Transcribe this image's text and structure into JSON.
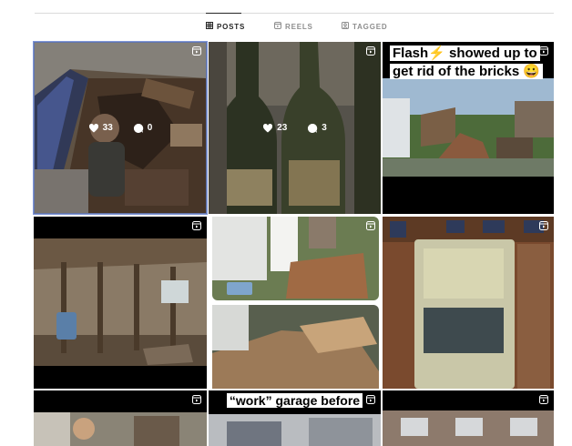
{
  "tabs": [
    {
      "label": "POSTS",
      "icon": "grid-icon",
      "active": true
    },
    {
      "label": "REELS",
      "icon": "reels-icon",
      "active": false
    },
    {
      "label": "TAGGED",
      "icon": "tagged-icon",
      "active": false
    }
  ],
  "posts": [
    {
      "kind": "photo-basement-crawlspace",
      "likes": "33",
      "comments": "0",
      "selected": true
    },
    {
      "kind": "photo-old-bottles",
      "likes": "23",
      "comments": "3"
    },
    {
      "kind": "reel-flash-bricks",
      "caption_line1": "Flash⚡ showed up to",
      "caption_line2": "get rid of the bricks 😀"
    },
    {
      "kind": "reel-gutted-interior"
    },
    {
      "kind": "reel-lumber-piles"
    },
    {
      "kind": "reel-vending-machine"
    },
    {
      "kind": "reel-kid-portrait"
    },
    {
      "kind": "reel-work-garage",
      "caption": "“work” garage before"
    },
    {
      "kind": "reel-building-exterior"
    }
  ],
  "colors": {
    "selected_border": "#7f96d8",
    "tab_active": "#262626",
    "tab_inactive": "#8e8e8e"
  }
}
